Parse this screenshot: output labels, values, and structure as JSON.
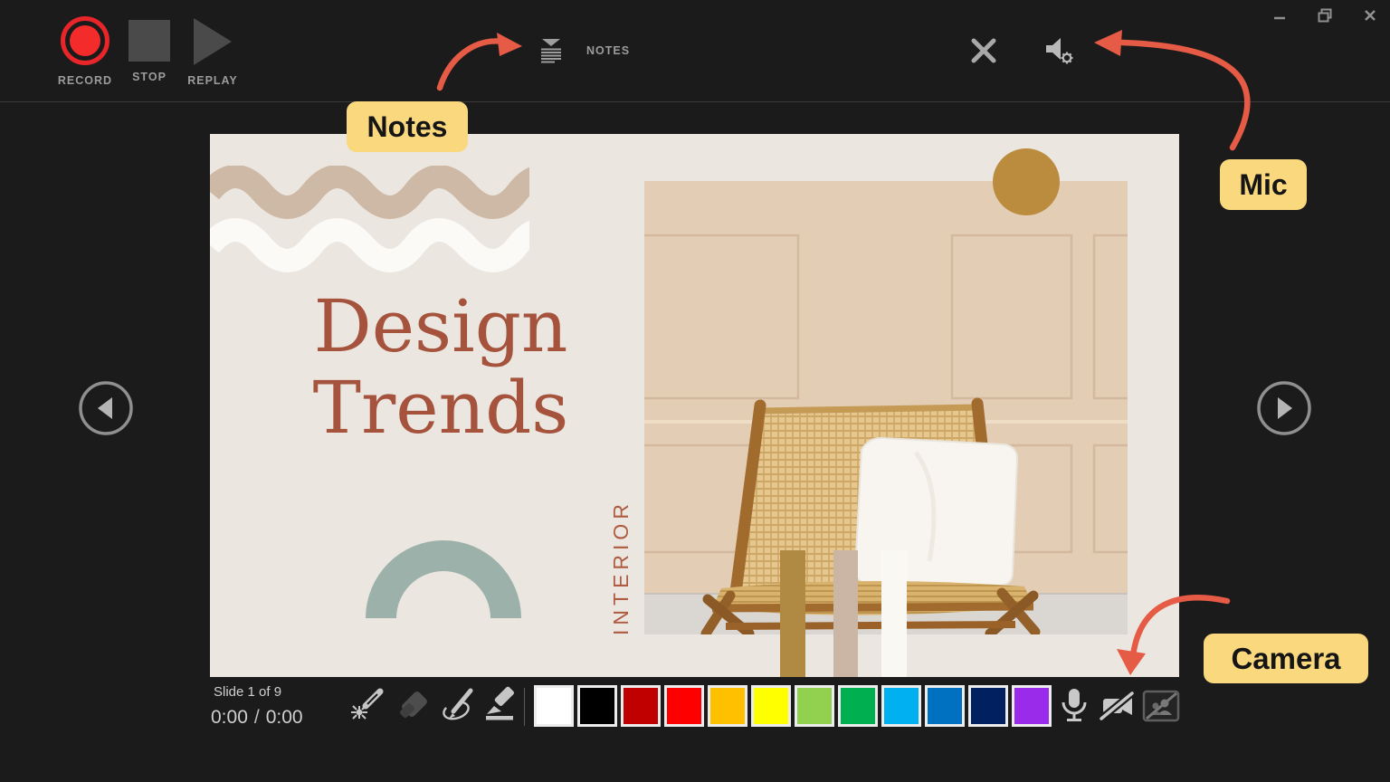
{
  "topbar": {
    "record_label": "RECORD",
    "stop_label": "STOP",
    "replay_label": "REPLAY",
    "notes_label": "NOTES"
  },
  "annotations": {
    "notes_label": "Notes",
    "mic_label": "Mic",
    "camera_label": "Camera"
  },
  "slide": {
    "number_text": "Slide 1 of 9",
    "elapsed": "0:00",
    "separator": "/",
    "total": "0:00",
    "title_line1": "Design",
    "title_line2": "Trends",
    "side_label": "INTERIOR"
  },
  "palette": {
    "colors": [
      {
        "name": "white",
        "hex": "#ffffff"
      },
      {
        "name": "black",
        "hex": "#000000"
      },
      {
        "name": "dark-red",
        "hex": "#c00000"
      },
      {
        "name": "red",
        "hex": "#ff0000"
      },
      {
        "name": "orange",
        "hex": "#ffc000"
      },
      {
        "name": "yellow",
        "hex": "#ffff00"
      },
      {
        "name": "light-green",
        "hex": "#92d050"
      },
      {
        "name": "green",
        "hex": "#00b050"
      },
      {
        "name": "light-blue",
        "hex": "#00b0f0"
      },
      {
        "name": "blue",
        "hex": "#0070c0"
      },
      {
        "name": "dark-blue",
        "hex": "#002060"
      },
      {
        "name": "purple",
        "hex": "#9b2bea"
      }
    ]
  },
  "colors": {
    "annotation_red": "#e55b45",
    "annotation_yellow": "#fad87d",
    "slide_bg": "#ebe6df",
    "title_terracotta": "#a5533d",
    "arch_sage": "#9cb1aa",
    "circle_gold": "#bc8c3e",
    "record_red": "#f32b2b"
  }
}
